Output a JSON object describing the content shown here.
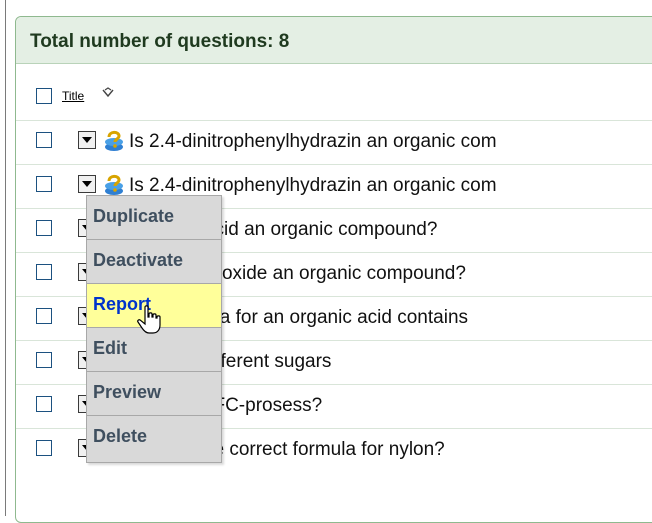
{
  "header": {
    "title": "Total number of questions: 8"
  },
  "table": {
    "title_column": "Title",
    "rows": [
      "Is 2.4-dinitrophenylhydrazin an organic com",
      "Is 2.4-dinitrophenylhydrazin an organic com",
      "Is acetic acid an organic compound?",
      "Is carbondioxide an organic compound?",
      "The formula for an organic acid contains",
      "Name 4 different sugars",
      "What is a FC-prosess?",
      "What is the correct formula for nylon?"
    ]
  },
  "context_menu": {
    "items": [
      "Duplicate",
      "Deactivate",
      "Report",
      "Edit",
      "Preview",
      "Delete"
    ],
    "active_item": "Report"
  },
  "colors": {
    "header_bg": "#e4efe4",
    "panel_border": "#8fb98f",
    "menu_bg": "#d9d9d9",
    "menu_active_bg": "#ffff9a",
    "menu_active_text": "#0033cc"
  }
}
